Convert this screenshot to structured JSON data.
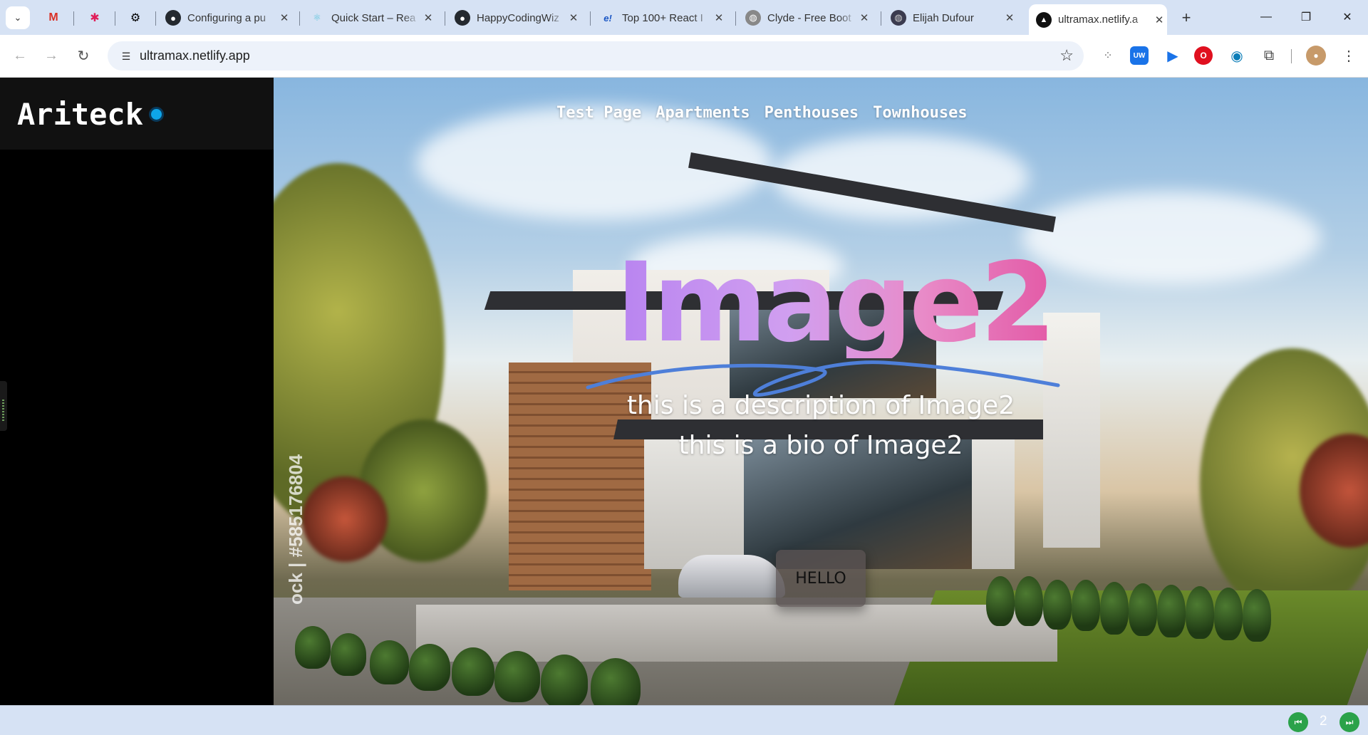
{
  "browser": {
    "tabs": [
      {
        "title": "Configuring a pu",
        "favicon": "github-icon"
      },
      {
        "title": "Quick Start – Rea",
        "favicon": "react-icon"
      },
      {
        "title": "HappyCodingWiz",
        "favicon": "github-icon"
      },
      {
        "title": "Top 100+ React I",
        "favicon": "e-icon"
      },
      {
        "title": "Clyde - Free Boot",
        "favicon": "globe-icon"
      },
      {
        "title": "Elijah Dufour",
        "favicon": "globe-icon"
      },
      {
        "title": "ultramax.netlify.a",
        "favicon": "netlify-icon"
      }
    ],
    "url": "ultramax.netlify.app"
  },
  "site": {
    "logo": "Ariteck",
    "nav": [
      "Test Page",
      "Apartments",
      "Penthouses",
      "Townhouses"
    ]
  },
  "hero": {
    "title": "Image2",
    "description": "this is a description of Image2",
    "bio": "this is a bio of Image2",
    "button_label": "HELLO",
    "watermark": "ock | #585176804"
  },
  "pager": {
    "current": "2"
  },
  "colors": {
    "logo_dot": "#0ea5e9",
    "title_gradient_start": "#b884f0",
    "title_gradient_end": "#e35aa6",
    "scribble": "#4e7fd9",
    "pager_button": "#2ba24a"
  }
}
